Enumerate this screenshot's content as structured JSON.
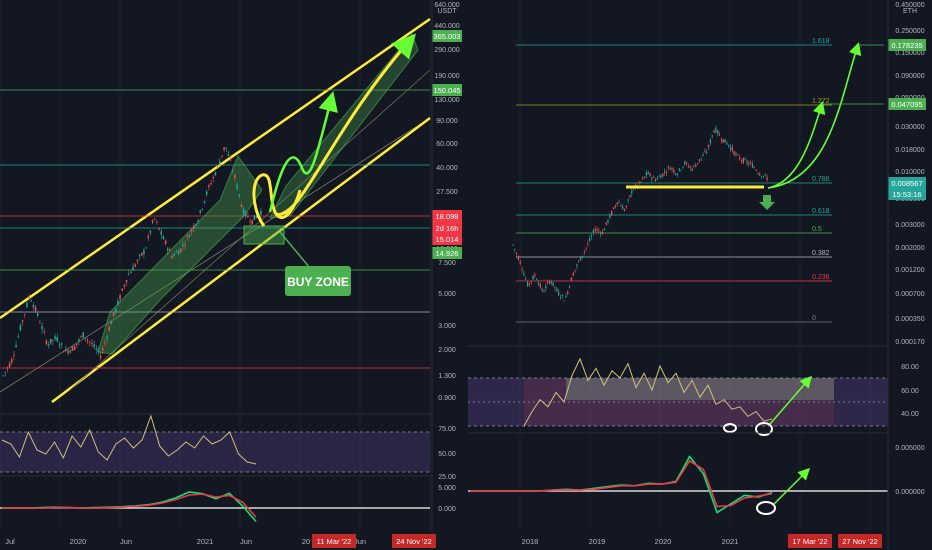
{
  "chart_data": [
    {
      "type": "line",
      "panel": "left-price",
      "scale": "log",
      "axis_unit": "USDT",
      "axis_ticks": [
        "640.000",
        "440.000",
        "290.000",
        "190.000",
        "130.000",
        "90.000",
        "60.000",
        "40.000",
        "27.500",
        "18.098",
        "15.014",
        "10.000",
        "7.500",
        "5.000",
        "3.000",
        "2.000",
        "1.300",
        "0.900"
      ],
      "price_badges": [
        {
          "text": "365.003",
          "color": "#4caf50"
        },
        {
          "text": "150.045",
          "color": "#4caf50"
        },
        {
          "text": "18.098",
          "color": "#f23645"
        },
        {
          "text": "2d 16h",
          "color": "#f23645"
        },
        {
          "text": "15.014",
          "color": "#f23645"
        },
        {
          "text": "14.926",
          "color": "#4caf50"
        }
      ],
      "x_labels": [
        "Jul",
        "2020",
        "Jun",
        "2021",
        "Jun",
        "20",
        "Jun"
      ],
      "date_badges": [
        "11 Mar '22",
        "24 Nov '22"
      ],
      "annotation": "BUY ZONE",
      "close_values": [
        0.9,
        1.2,
        2.2,
        3.9,
        2.6,
        1.6,
        1.8,
        1.4,
        1.5,
        1.9,
        1.6,
        1.3,
        2.2,
        3.5,
        5.5,
        7.0,
        9.0,
        16,
        11,
        8,
        9,
        12,
        16,
        26,
        38,
        60,
        35,
        18,
        15,
        18
      ]
    },
    {
      "type": "line",
      "panel": "left-rsi",
      "axis_ticks": [
        "75.00",
        "50.00",
        "25.00"
      ],
      "band": [
        30,
        70
      ],
      "values": [
        62,
        58,
        45,
        70,
        52,
        48,
        60,
        44,
        66,
        55,
        72,
        50,
        42,
        58,
        64,
        54,
        62,
        86,
        56,
        46,
        52,
        60,
        54,
        66,
        58,
        62,
        70,
        48,
        40,
        38
      ]
    },
    {
      "type": "line",
      "panel": "left-macd",
      "axis_ticks": [
        "5.000",
        "0.000"
      ],
      "series": [
        {
          "values": [
            0,
            0,
            0,
            0.1,
            0.2,
            0.1,
            0,
            0.1,
            0.2,
            0.3,
            0.5,
            0.8,
            1.4,
            2.4,
            3.8,
            3.4,
            2.2,
            3.5,
            0.5,
            -3.2
          ]
        },
        {
          "values": [
            0,
            0,
            0,
            0,
            0.1,
            0.1,
            0,
            0,
            0.1,
            0.2,
            0.4,
            0.7,
            1.2,
            2.0,
            3.1,
            3.3,
            2.6,
            3.0,
            1.4,
            -2.2
          ]
        }
      ]
    },
    {
      "type": "line",
      "panel": "right-price",
      "scale": "log",
      "axis_unit": "ETH",
      "axis_ticks": [
        "0.450000",
        "0.250000",
        "0.150000",
        "0.090000",
        "0.050000",
        "0.030000",
        "0.018000",
        "0.010000",
        "0.005000",
        "0.003000",
        "0.002000",
        "0.001200",
        "0.000700",
        "0.000350",
        "0.000170"
      ],
      "fib_levels": [
        {
          "label": "1.618",
          "color": "#26a69a"
        },
        {
          "label": "1.272",
          "color": "#9fa61e"
        },
        {
          "label": "0.786",
          "color": "#26a69a"
        },
        {
          "label": "0.618",
          "color": "#26a69a"
        },
        {
          "label": "0.5",
          "color": "#4caf50"
        },
        {
          "label": "0.382",
          "color": "#b2b5be"
        },
        {
          "label": "0.236",
          "color": "#f23645"
        },
        {
          "label": "0",
          "color": "#787b86"
        }
      ],
      "price_badges": [
        {
          "text": "0.178235",
          "color": "#4caf50"
        },
        {
          "text": "0.047095",
          "color": "#4caf50"
        },
        {
          "text": "0.008567",
          "color": "#26a69a"
        },
        {
          "text": "15:53:16",
          "color": "#26a69a"
        }
      ],
      "x_labels": [
        "2018",
        "2019",
        "2020",
        "2021"
      ],
      "date_badges": [
        "17 Mar '22",
        "27 Nov '22"
      ],
      "close_values": [
        0.0018,
        0.0012,
        0.0007,
        0.0009,
        0.0006,
        0.0008,
        0.0006,
        0.0005,
        0.0009,
        0.0013,
        0.0018,
        0.0026,
        0.0024,
        0.0035,
        0.005,
        0.004,
        0.0065,
        0.0075,
        0.0095,
        0.0082,
        0.0092,
        0.011,
        0.0095,
        0.012,
        0.0105,
        0.013,
        0.016,
        0.027,
        0.021,
        0.018,
        0.014,
        0.0125,
        0.0115,
        0.0095,
        0.0085
      ]
    },
    {
      "type": "line",
      "panel": "right-rsi",
      "axis_ticks": [
        "80.00",
        "60.00",
        "40.00"
      ],
      "values": [
        30,
        42,
        52,
        46,
        58,
        50,
        72,
        86,
        68,
        78,
        64,
        76,
        70,
        82,
        62,
        74,
        60,
        80,
        66,
        74,
        58,
        68,
        54,
        64,
        48,
        52,
        44,
        46,
        38,
        42,
        34,
        36
      ]
    },
    {
      "type": "line",
      "panel": "right-macd",
      "axis_ticks": [
        "0.005000",
        "0.000000"
      ],
      "series": [
        {
          "values": [
            0,
            0,
            0,
            0,
            0,
            0,
            0.0001,
            0.0002,
            0.0001,
            0.0003,
            0.0005,
            0.0007,
            0.0006,
            0.0009,
            0.0008,
            0.0011,
            0.004,
            0.002,
            -0.0025,
            -0.0015,
            -0.0005,
            -0.0007,
            -0.0002
          ]
        },
        {
          "values": [
            0,
            0,
            0,
            0,
            0,
            0,
            0.0001,
            0.0001,
            0.0001,
            0.0002,
            0.0004,
            0.0006,
            0.0006,
            0.0008,
            0.0008,
            0.001,
            0.0035,
            0.0025,
            -0.0018,
            -0.0017,
            -0.0008,
            -0.0006,
            -0.0003
          ]
        }
      ]
    }
  ]
}
